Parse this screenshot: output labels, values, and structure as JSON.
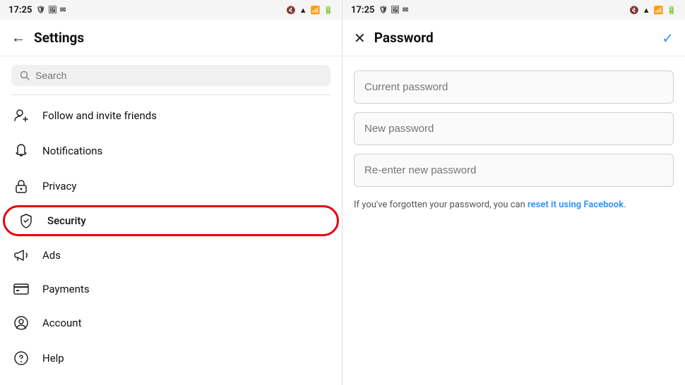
{
  "left": {
    "statusBar": {
      "time": "17:25",
      "icons": [
        "🛡",
        "🖼",
        "✉"
      ]
    },
    "header": {
      "back": "←",
      "title": "Settings"
    },
    "search": {
      "placeholder": "Search"
    },
    "menuItems": [
      {
        "id": "follow",
        "label": "Follow and invite friends",
        "icon": "follow"
      },
      {
        "id": "notifications",
        "label": "Notifications",
        "icon": "bell"
      },
      {
        "id": "privacy",
        "label": "Privacy",
        "icon": "lock"
      },
      {
        "id": "security",
        "label": "Security",
        "icon": "shield",
        "highlighted": true
      },
      {
        "id": "ads",
        "label": "Ads",
        "icon": "megaphone"
      },
      {
        "id": "payments",
        "label": "Payments",
        "icon": "card"
      },
      {
        "id": "account",
        "label": "Account",
        "icon": "circle-user"
      },
      {
        "id": "help",
        "label": "Help",
        "icon": "circle-question"
      }
    ]
  },
  "right": {
    "statusBar": {
      "time": "17:25"
    },
    "header": {
      "close": "✕",
      "title": "Password",
      "check": "✓"
    },
    "form": {
      "currentPasswordPlaceholder": "Current password",
      "newPasswordPlaceholder": "New password",
      "reenterPlaceholder": "Re-enter new password",
      "forgotText": "If you've forgotten your password, you can ",
      "resetLinkText": "reset it using Facebook",
      "forgotTextEnd": "."
    }
  }
}
